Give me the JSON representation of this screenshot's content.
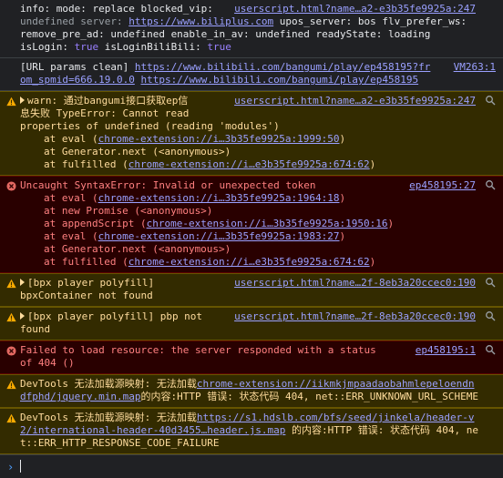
{
  "info1": {
    "line1": "info: mode: replace blocked_vip:",
    "src": "userscript.html?name…a2-e3b35fe9925a:247",
    "line2a": "undefined server: ",
    "server_url": "https://www.biliplus.com",
    "line2b": " upos_server: bos flv_prefer_ws:",
    "line3": "remove_pre_ad: undefined enable_in_av: undefined readyState: loading",
    "line4a": "isLogin: ",
    "isLogin": "true",
    "line4b": " isLoginBiliBili: ",
    "isLoginBiliBili": "true"
  },
  "info2": {
    "prefix": "[URL params clean] ",
    "url1": "https://www.bilibili.com/bangumi/play/ep458195?fr",
    "src": "VM263:1",
    "url1b": "om_spmid=666.19.0.0",
    "url2": "https://www.bilibili.com/bangumi/play/ep458195"
  },
  "warn1": {
    "title": "warn: 通过bangumi接口获取ep信",
    "src": "userscript.html?name…a2-e3b35fe9925a:247",
    "line2": "息失败 TypeError: Cannot read",
    "line3": "properties of undefined (reading 'modules')",
    "stack": [
      {
        "pre": "at eval (",
        "link": "chrome-extension://i…3b35fe9925a:1999:50",
        "post": ")"
      },
      {
        "pre": "at Generator.next (<anonymous>)",
        "link": "",
        "post": ""
      },
      {
        "pre": "at fulfilled (",
        "link": "chrome-extension://i…e3b35fe9925a:674:62",
        "post": ")"
      }
    ]
  },
  "error1": {
    "title": "Uncaught SyntaxError: Invalid or unexpected token",
    "src": "ep458195:27",
    "stack": [
      {
        "pre": "at eval (",
        "link": "chrome-extension://i…3b35fe9925a:1964:18",
        "post": ")"
      },
      {
        "pre": "at new Promise (<anonymous>)",
        "link": "",
        "post": ""
      },
      {
        "pre": "at appendScript (",
        "link": "chrome-extension://i…3b35fe9925a:1950:16",
        "post": ")"
      },
      {
        "pre": "at eval (",
        "link": "chrome-extension://i…3b35fe9925a:1983:27",
        "post": ")"
      },
      {
        "pre": "at Generator.next (<anonymous>)",
        "link": "",
        "post": ""
      },
      {
        "pre": "at fulfilled (",
        "link": "chrome-extension://i…e3b35fe9925a:674:62",
        "post": ")"
      }
    ]
  },
  "warn2": {
    "line1": "[bpx player polyfill]",
    "src": "userscript.html?name…2f-8eb3a20ccec0:190",
    "line2": "bpxContainer not found"
  },
  "warn3": {
    "line1": "[bpx player polyfill] pbp not",
    "src": "userscript.html?name…2f-8eb3a20ccec0:190",
    "line2": "found"
  },
  "error2": {
    "line1": "Failed to load resource: the server responded with a status",
    "src": "ep458195:1",
    "line2": "of 404 ()"
  },
  "warn4": {
    "pre": "DevTools 无法加载源映射: 无法加载",
    "link": "chrome-extension://iikmkjmpaadaobahmlepeloendndfphd/jquery.min.map",
    "post": "的内容:HTTP 错误: 状态代码 404, net::ERR_UNKNOWN_URL_SCHEME"
  },
  "warn5": {
    "pre": "DevTools 无法加载源映射: 无法加载",
    "link1": "https://s1.hdslb.com/bfs/seed/jinkela/header-v2/international-header-40d3455…header.js.map",
    "post": " 的内容:HTTP 错误: 状态代码 404, net::ERR_HTTP_RESPONSE_CODE_FAILURE"
  },
  "icons": {
    "warn": "warning-triangle-icon",
    "error": "error-circle-icon",
    "search": "magnifier-icon",
    "prompt": "chevron-right-icon"
  },
  "colors": {
    "background": "#202124",
    "warn_bg": "#332b00",
    "warn_text": "#ffdc9e",
    "error_bg": "#290000",
    "error_text": "#ff8080",
    "link": "#9aa0ff"
  }
}
